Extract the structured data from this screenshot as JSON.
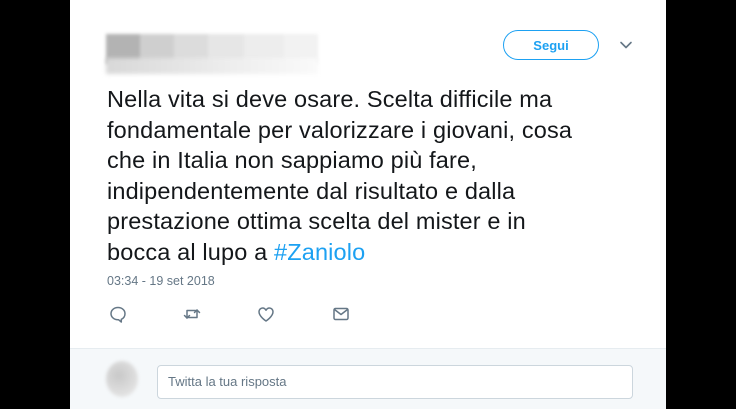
{
  "header": {
    "follow_label": "Segui",
    "menu_icon": "chevron-down-icon"
  },
  "tweet": {
    "lines": [
      "Nella vita si deve osare. Scelta difficile ma",
      "fondamentale per valorizzare i giovani, cosa",
      "che in Italia non sappiamo più fare,",
      "indipendentemente dal risultato e dalla",
      "prestazione ottima scelta del mister e in",
      "bocca al lupo a "
    ],
    "hashtag": "#Zaniolo",
    "timestamp": "03:34 - 19 set 2018"
  },
  "actions": {
    "icons": [
      "reply-icon",
      "retweet-icon",
      "like-icon",
      "message-icon"
    ]
  },
  "reply": {
    "placeholder": "Twitta la tua risposta"
  },
  "colors": {
    "accent": "#1da1f2",
    "text": "#14171a",
    "muted": "#657786",
    "background": "#000000"
  }
}
